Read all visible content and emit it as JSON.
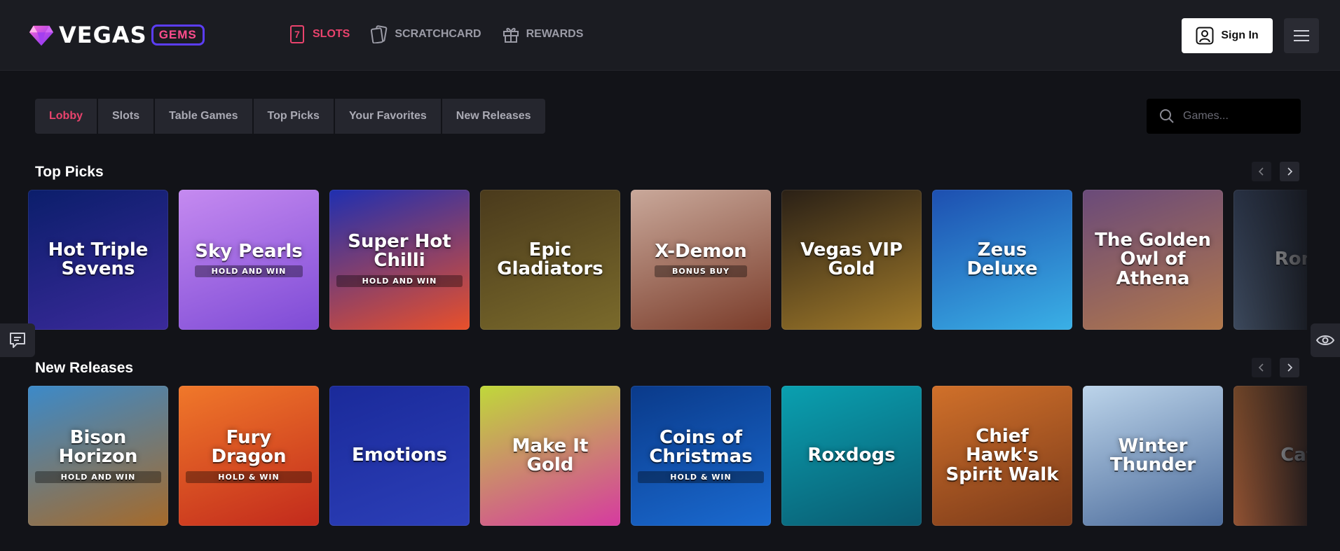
{
  "brand": {
    "name": "VEGAS",
    "badge": "GEMS"
  },
  "nav": [
    {
      "label": "SLOTS",
      "icon": "slot-seven-icon",
      "active": true
    },
    {
      "label": "SCRATCHCARD",
      "icon": "scratchcard-icon",
      "active": false
    },
    {
      "label": "REWARDS",
      "icon": "gift-icon",
      "active": false
    }
  ],
  "header": {
    "signin_label": "Sign In"
  },
  "tabs": [
    {
      "label": "Lobby",
      "active": true
    },
    {
      "label": "Slots"
    },
    {
      "label": "Table Games"
    },
    {
      "label": "Top Picks"
    },
    {
      "label": "Your Favorites"
    },
    {
      "label": "New Releases"
    }
  ],
  "search": {
    "placeholder": "Games..."
  },
  "sections": {
    "top_picks": {
      "title": "Top Picks",
      "games": [
        {
          "title": "Hot Triple Sevens",
          "colors": [
            "#0b1e6b",
            "#3b2a9b"
          ]
        },
        {
          "title": "Sky Pearls",
          "sub": "HOLD AND WIN",
          "colors": [
            "#c58af0",
            "#7e4bd6"
          ]
        },
        {
          "title": "Super Hot Chilli",
          "sub": "HOLD AND WIN",
          "colors": [
            "#1f2fb0",
            "#e9502a"
          ]
        },
        {
          "title": "Epic Gladiators",
          "colors": [
            "#4a3a1c",
            "#7a6a2b"
          ]
        },
        {
          "title": "X-Demon",
          "sub": "BONUS BUY",
          "colors": [
            "#c9a89a",
            "#7a3c2a"
          ]
        },
        {
          "title": "Vegas VIP Gold",
          "colors": [
            "#2a2016",
            "#a07a2a"
          ]
        },
        {
          "title": "Zeus Deluxe",
          "colors": [
            "#1d4fb0",
            "#3ab0e6"
          ]
        },
        {
          "title": "The Golden Owl of Athena",
          "colors": [
            "#6a4a7a",
            "#b2784a"
          ]
        },
        {
          "title": "Roma",
          "colors": [
            "#2a3448",
            "#4a5a70"
          ]
        }
      ]
    },
    "new_releases": {
      "title": "New Releases",
      "games": [
        {
          "title": "Bison Horizon",
          "sub": "HOLD AND WIN",
          "colors": [
            "#3c8ac9",
            "#a66a2a"
          ]
        },
        {
          "title": "Fury Dragon",
          "sub": "HOLD & WIN",
          "colors": [
            "#f0782a",
            "#c22a1c"
          ]
        },
        {
          "title": "Emotions",
          "colors": [
            "#1a2a9a",
            "#2c3fb8"
          ]
        },
        {
          "title": "Make It Gold",
          "colors": [
            "#c0d83a",
            "#d63aa0"
          ]
        },
        {
          "title": "Coins of Christmas",
          "sub": "HOLD & WIN",
          "colors": [
            "#0a3a8a",
            "#1a6ad0"
          ]
        },
        {
          "title": "Roxdogs",
          "colors": [
            "#0aa0b0",
            "#0a5a70"
          ]
        },
        {
          "title": "Chief Hawk's Spirit Walk",
          "colors": [
            "#d0702a",
            "#7a3a1a"
          ]
        },
        {
          "title": "Winter Thunder",
          "colors": [
            "#bcd4ea",
            "#4a6a9a"
          ]
        },
        {
          "title": "Cafe",
          "colors": [
            "#7a4a2a",
            "#b0603a"
          ]
        }
      ]
    }
  },
  "colors": {
    "accent": "#e9436d",
    "badge_border": "#5b3df5",
    "bg": "#121318",
    "header_bg": "#1b1c22"
  }
}
